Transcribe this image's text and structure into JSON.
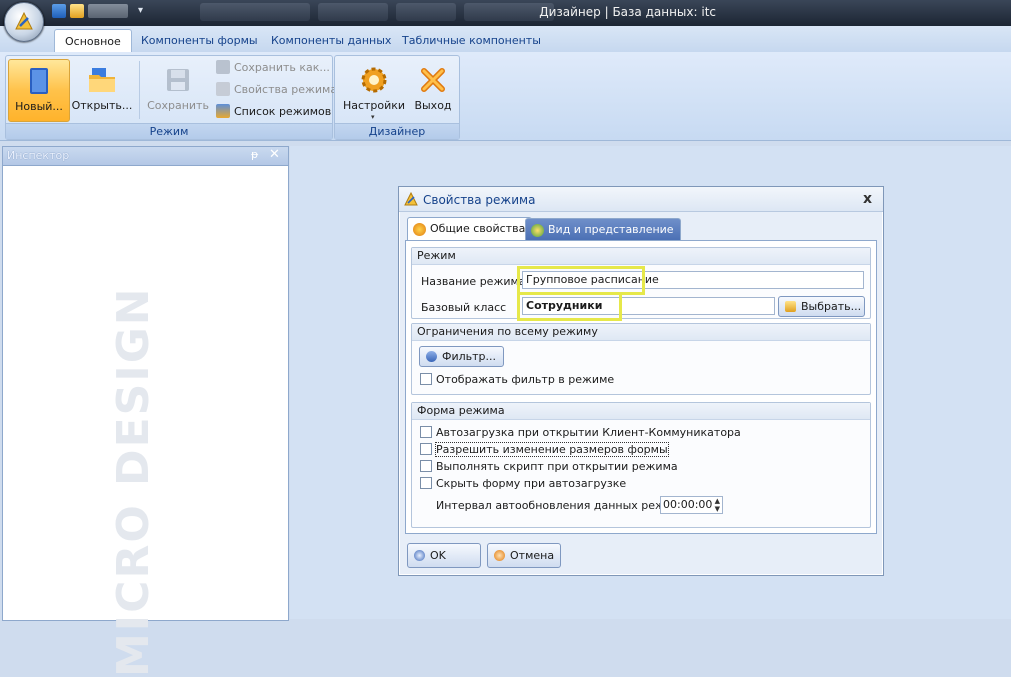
{
  "window": {
    "title": "Дизайнер | База данных: itc"
  },
  "ribbon": {
    "tabs": [
      {
        "label": "Основное",
        "active": true
      },
      {
        "label": "Компоненты формы",
        "active": false
      },
      {
        "label": "Компоненты данных",
        "active": false
      },
      {
        "label": "Табличные компоненты",
        "active": false
      }
    ],
    "groups": {
      "mode": {
        "label": "Режим",
        "new_label": "Новый...",
        "open_label": "Открыть...",
        "save_label": "Сохранить",
        "save_as_label": "Сохранить как...",
        "mode_props_label": "Свойства режима",
        "mode_list_label": "Список режимов"
      },
      "designer": {
        "label": "Дизайнер",
        "settings_label": "Настройки",
        "exit_label": "Выход"
      }
    }
  },
  "inspector": {
    "title": "Инспектор",
    "pin": "ᵽ",
    "close": "✕",
    "watermark": "MICRO DESIGN"
  },
  "dialog": {
    "title": "Свойства режима",
    "close": "x",
    "tabs": {
      "general": "Общие свойства",
      "view": "Вид и представление"
    },
    "mode_group": {
      "header": "Режим",
      "name_label": "Название режима",
      "name_value": "Групповое расписание",
      "base_class_label": "Базовый класс",
      "base_class_value": "Сотрудники",
      "choose_button": "Выбрать..."
    },
    "limits_group": {
      "header": "Ограничения по всему режиму",
      "filter_button": "Фильтр...",
      "show_filter": "Отображать фильтр в режиме"
    },
    "form_group": {
      "header": "Форма режима",
      "autoload": "Автозагрузка при открытии Клиент-Коммуникатора",
      "allow_resize": "Разрешить изменение размеров формы",
      "run_script": "Выполнять скрипт при открытии режима",
      "hide_form": "Скрыть форму при автозагрузке",
      "interval_label": "Интервал автообновления данных режима",
      "interval_value": "00:00:00"
    },
    "ok_button": "OK",
    "cancel_button": "Отмена"
  },
  "colors": {
    "accent": "#15428b",
    "highlight": "#e6e84a",
    "hot_button": "#ffc24a"
  }
}
